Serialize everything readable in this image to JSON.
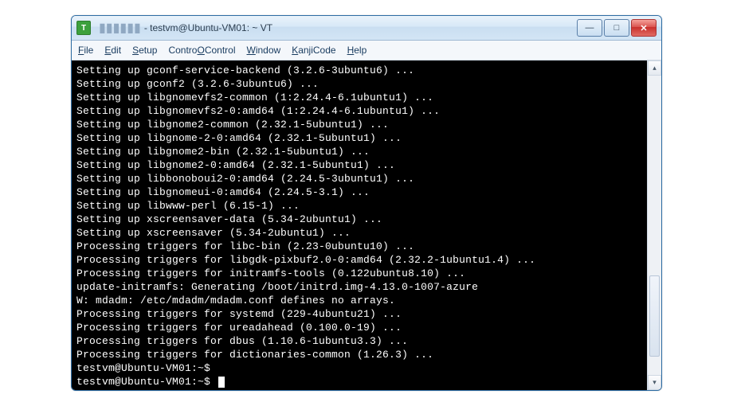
{
  "window": {
    "title_suffix": " - testvm@Ubuntu-VM01: ~ VT",
    "icon_letter": "T"
  },
  "menu": {
    "items": [
      {
        "label": "File",
        "key": "F"
      },
      {
        "label": "Edit",
        "key": "E"
      },
      {
        "label": "Setup",
        "key": "S"
      },
      {
        "label": "Control",
        "key": "O"
      },
      {
        "label": "Window",
        "key": "W"
      },
      {
        "label": "KanjiCode",
        "key": "K"
      },
      {
        "label": "Help",
        "key": "H"
      }
    ]
  },
  "terminal": {
    "lines": [
      "Setting up gconf-service-backend (3.2.6-3ubuntu6) ...",
      "Setting up gconf2 (3.2.6-3ubuntu6) ...",
      "Setting up libgnomevfs2-common (1:2.24.4-6.1ubuntu1) ...",
      "Setting up libgnomevfs2-0:amd64 (1:2.24.4-6.1ubuntu1) ...",
      "Setting up libgnome2-common (2.32.1-5ubuntu1) ...",
      "Setting up libgnome-2-0:amd64 (2.32.1-5ubuntu1) ...",
      "Setting up libgnome2-bin (2.32.1-5ubuntu1) ...",
      "Setting up libgnome2-0:amd64 (2.32.1-5ubuntu1) ...",
      "Setting up libbonoboui2-0:amd64 (2.24.5-3ubuntu1) ...",
      "Setting up libgnomeui-0:amd64 (2.24.5-3.1) ...",
      "Setting up libwww-perl (6.15-1) ...",
      "Setting up xscreensaver-data (5.34-2ubuntu1) ...",
      "Setting up xscreensaver (5.34-2ubuntu1) ...",
      "Processing triggers for libc-bin (2.23-0ubuntu10) ...",
      "Processing triggers for libgdk-pixbuf2.0-0:amd64 (2.32.2-1ubuntu1.4) ...",
      "Processing triggers for initramfs-tools (0.122ubuntu8.10) ...",
      "update-initramfs: Generating /boot/initrd.img-4.13.0-1007-azure",
      "W: mdadm: /etc/mdadm/mdadm.conf defines no arrays.",
      "Processing triggers for systemd (229-4ubuntu21) ...",
      "Processing triggers for ureadahead (0.100.0-19) ...",
      "Processing triggers for dbus (1.10.6-1ubuntu3.3) ...",
      "Processing triggers for dictionaries-common (1.26.3) ...",
      "testvm@Ubuntu-VM01:~$",
      "testvm@Ubuntu-VM01:~$ "
    ]
  },
  "controls": {
    "minimize": "—",
    "maximize": "□",
    "close": "✕",
    "scroll_up": "▴",
    "scroll_down": "▾"
  }
}
